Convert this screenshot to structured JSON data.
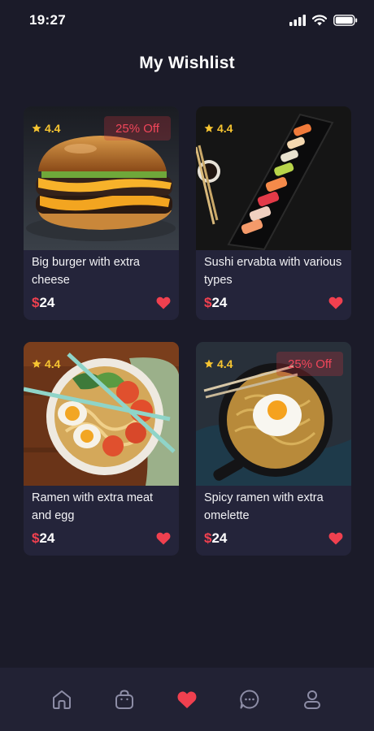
{
  "status_bar": {
    "time": "19:27"
  },
  "page": {
    "title": "My Wishlist"
  },
  "colors": {
    "accent": "#f0404f",
    "rating": "#f7c531",
    "card_bg": "#24243a",
    "background": "#1b1b29"
  },
  "wishlist": [
    {
      "name": "Big burger with extra cheese",
      "rating": "4.4",
      "discount": "25% Off",
      "currency": "$",
      "price": "24",
      "image_icon": "burger-image"
    },
    {
      "name": "Sushi ervabta with various types",
      "rating": "4.4",
      "discount": "",
      "currency": "$",
      "price": "24",
      "image_icon": "sushi-image"
    },
    {
      "name": "Ramen with extra meat and  egg",
      "rating": "4.4",
      "discount": "",
      "currency": "$",
      "price": "24",
      "image_icon": "ramen-image"
    },
    {
      "name": "Spicy ramen with extra omelette",
      "rating": "4.4",
      "discount": "25% Off",
      "currency": "$",
      "price": "24",
      "image_icon": "spicy-ramen-image"
    }
  ],
  "bottom_nav": {
    "items": [
      {
        "icon": "home-icon",
        "active": false
      },
      {
        "icon": "bag-icon",
        "active": false
      },
      {
        "icon": "heart-icon",
        "active": true
      },
      {
        "icon": "chat-icon",
        "active": false
      },
      {
        "icon": "profile-icon",
        "active": false
      }
    ]
  }
}
